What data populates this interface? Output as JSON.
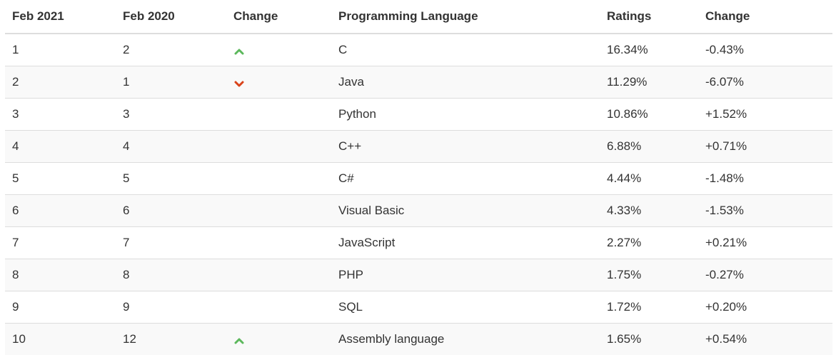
{
  "table": {
    "headers": [
      "Feb 2021",
      "Feb 2020",
      "Change",
      "Programming Language",
      "Ratings",
      "Change"
    ],
    "colors": {
      "up": "#5cb85c",
      "down": "#d9431a"
    },
    "rows": [
      {
        "rank_2021": "1",
        "rank_2020": "2",
        "trend": "up",
        "trend_icon": "chevron-up-icon",
        "language": "C",
        "rating": "16.34%",
        "change": "-0.43%"
      },
      {
        "rank_2021": "2",
        "rank_2020": "1",
        "trend": "down",
        "trend_icon": "chevron-down-icon",
        "language": "Java",
        "rating": "11.29%",
        "change": "-6.07%"
      },
      {
        "rank_2021": "3",
        "rank_2020": "3",
        "trend": "",
        "trend_icon": "",
        "language": "Python",
        "rating": "10.86%",
        "change": "+1.52%"
      },
      {
        "rank_2021": "4",
        "rank_2020": "4",
        "trend": "",
        "trend_icon": "",
        "language": "C++",
        "rating": "6.88%",
        "change": "+0.71%"
      },
      {
        "rank_2021": "5",
        "rank_2020": "5",
        "trend": "",
        "trend_icon": "",
        "language": "C#",
        "rating": "4.44%",
        "change": "-1.48%"
      },
      {
        "rank_2021": "6",
        "rank_2020": "6",
        "trend": "",
        "trend_icon": "",
        "language": "Visual Basic",
        "rating": "4.33%",
        "change": "-1.53%"
      },
      {
        "rank_2021": "7",
        "rank_2020": "7",
        "trend": "",
        "trend_icon": "",
        "language": "JavaScript",
        "rating": "2.27%",
        "change": "+0.21%"
      },
      {
        "rank_2021": "8",
        "rank_2020": "8",
        "trend": "",
        "trend_icon": "",
        "language": "PHP",
        "rating": "1.75%",
        "change": "-0.27%"
      },
      {
        "rank_2021": "9",
        "rank_2020": "9",
        "trend": "",
        "trend_icon": "",
        "language": "SQL",
        "rating": "1.72%",
        "change": "+0.20%"
      },
      {
        "rank_2021": "10",
        "rank_2020": "12",
        "trend": "up",
        "trend_icon": "chevron-up-icon",
        "language": "Assembly language",
        "rating": "1.65%",
        "change": "+0.54%"
      }
    ]
  }
}
